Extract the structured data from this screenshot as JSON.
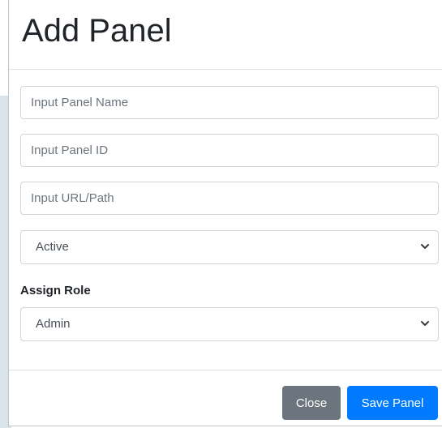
{
  "modal": {
    "title": "Add Panel",
    "fields": {
      "panel_name_placeholder": "Input Panel Name",
      "panel_id_placeholder": "Input Panel ID",
      "url_placeholder": "Input URL/Path"
    },
    "status_select": {
      "value": "Active",
      "icon": "chevron-down-icon"
    },
    "assign_role": {
      "label": "Assign Role",
      "value": "Admin",
      "icon": "chevron-down-icon"
    },
    "footer": {
      "close_label": "Close",
      "save_label": "Save Panel"
    }
  },
  "colors": {
    "primary": "#007bff",
    "secondary": "#6c757d",
    "backdrop": "#d9e3ea"
  }
}
